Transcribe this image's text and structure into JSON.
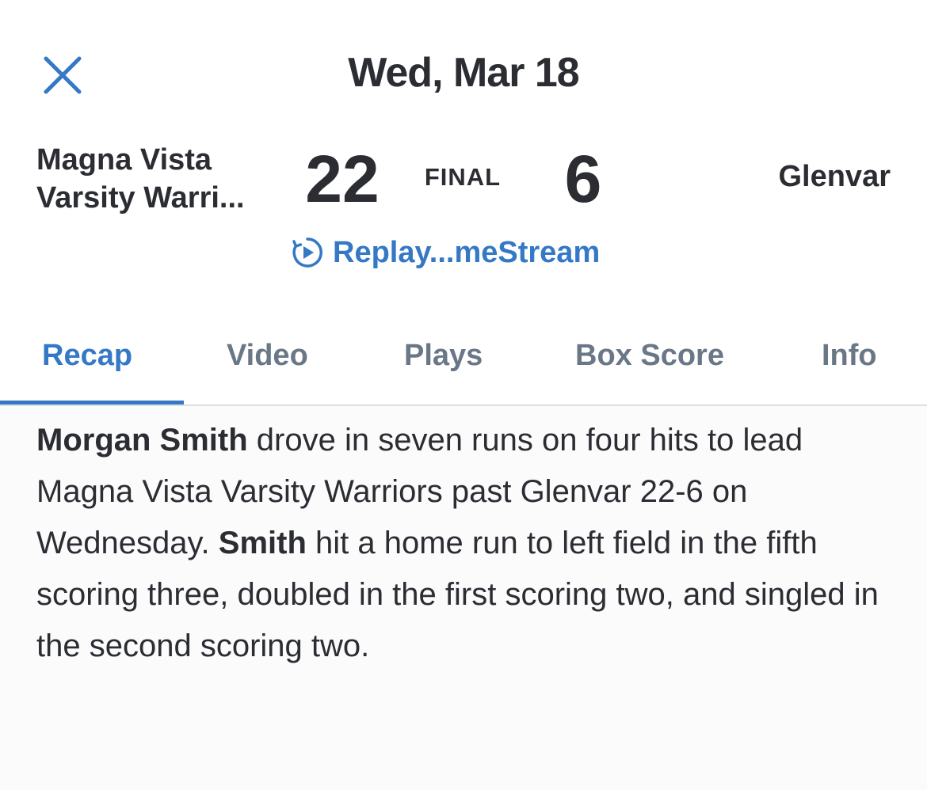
{
  "header": {
    "title": "Wed, Mar 18",
    "close_icon": "close-icon"
  },
  "game": {
    "home_team_line1": "Magna Vista",
    "home_team_line2": "Varsity Warri...",
    "home_score": "22",
    "status": "FINAL",
    "away_score": "6",
    "away_team": "Glenvar"
  },
  "replay": {
    "icon": "replay-icon",
    "label": "Replay...meStream"
  },
  "tabs": [
    {
      "label": "Recap",
      "active": true
    },
    {
      "label": "Video",
      "active": false
    },
    {
      "label": "Plays",
      "active": false
    },
    {
      "label": "Box Score",
      "active": false
    },
    {
      "label": "Info",
      "active": false
    }
  ],
  "recap": {
    "player_name": "Morgan Smith",
    "sentence1": " drove in seven runs on four hits to lead Magna Vista Varsity Warriors past Glenvar 22-6 on Wednesday. ",
    "player_last": "Smith",
    "sentence2": " hit a home run to left field in the fifth scoring three, doubled in the first scoring two, and singled in the second scoring two."
  },
  "colors": {
    "accent": "#3478c6",
    "text": "#2b2d33",
    "tab_inactive": "#6a7787",
    "divider": "#dcdfe4"
  }
}
